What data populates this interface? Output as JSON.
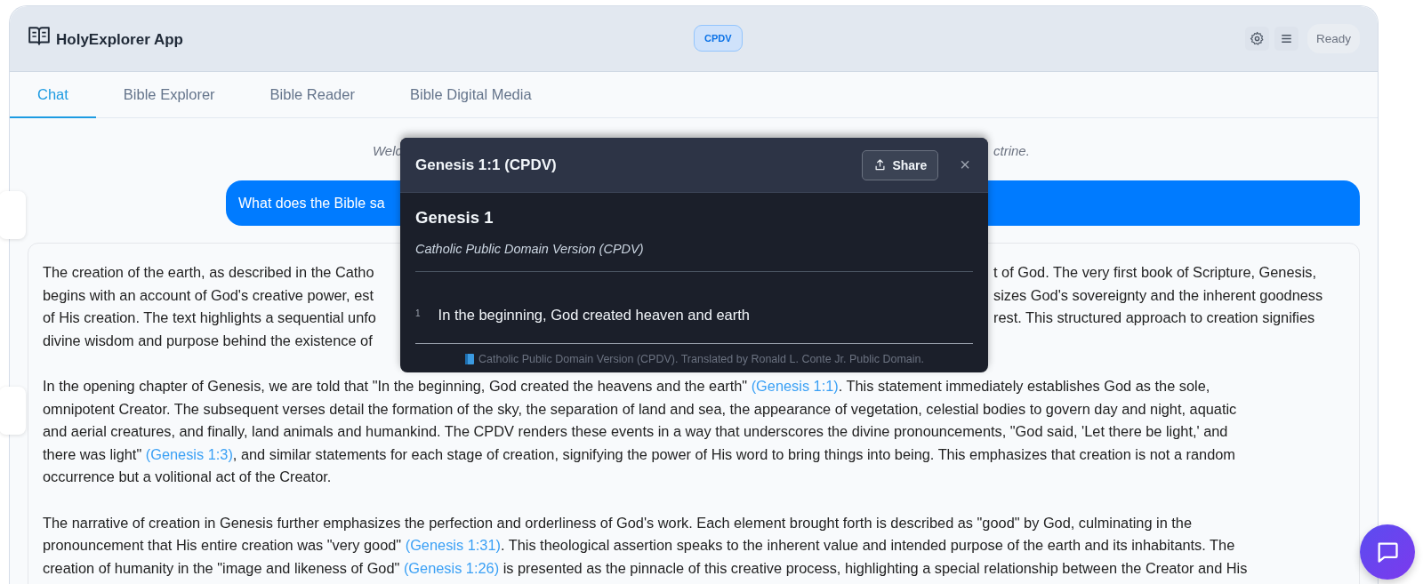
{
  "app": {
    "title": "HolyExplorer App",
    "version_badge": "CPDV",
    "status": "Ready"
  },
  "tabs": [
    {
      "label": "Chat",
      "selected": true
    },
    {
      "label": "Bible Explorer",
      "selected": false
    },
    {
      "label": "Bible Reader",
      "selected": false
    },
    {
      "label": "Bible Digital Media",
      "selected": false
    }
  ],
  "chat": {
    "welcome": {
      "left": "Welc",
      "right": "ctrine."
    },
    "user_message": "What does the Bible sa",
    "answer": {
      "paragraphs": [
        {
          "lines": [
            {
              "left": [
                {
                  "kind": "text",
                  "text": "The creation of the earth, as described in the Catho"
                }
              ],
              "right": [
                {
                  "kind": "text",
                  "text": "t of God. The very first book of Scripture, Genesis,"
                }
              ]
            },
            {
              "left": [
                {
                  "kind": "text",
                  "text": "begins with an account of God's creative power, est"
                }
              ],
              "right": [
                {
                  "kind": "text",
                  "text": "sizes God's sovereignty and the inherent goodness"
                }
              ]
            },
            {
              "left": [
                {
                  "kind": "text",
                  "text": "of His creation. The text highlights a sequential unfo"
                }
              ],
              "right": [
                {
                  "kind": "text",
                  "text": "rest. This structured approach to creation signifies"
                }
              ]
            },
            {
              "left": [
                {
                  "kind": "text",
                  "text": "divine wisdom and purpose behind the existence of"
                }
              ]
            }
          ]
        },
        {
          "lines": [
            {
              "left": [
                {
                  "kind": "text",
                  "text": "In the opening chapter of Genesis, we are told that \"In the beginning, God created the heavens and the earth\""
                },
                {
                  "kind": "link",
                  "text": "(Genesis 1:1)"
                },
                {
                  "kind": "text",
                  "text": ". This statement immediately establishes God as the sole,"
                }
              ]
            },
            {
              "left": [
                {
                  "kind": "text",
                  "text": "omnipotent Creator. The subsequent verses detail the formation of the sky, the separation of land and sea, the appearance of vegetation, celestial bodies to govern day and night, aquatic"
                }
              ]
            },
            {
              "left": [
                {
                  "kind": "text",
                  "text": "and aerial creatures, and finally, land animals and humankind. The CPDV renders these events in a way that underscores the divine pronouncements, \"God said, 'Let there be light,' and"
                }
              ]
            },
            {
              "left": [
                {
                  "kind": "text",
                  "text": "there was light\""
                },
                {
                  "kind": "link",
                  "text": "(Genesis 1:3)"
                },
                {
                  "kind": "text",
                  "text": ", and similar statements for each stage of creation, signifying the power of His word to bring things into being. This emphasizes that creation is not a random"
                }
              ]
            },
            {
              "left": [
                {
                  "kind": "text",
                  "text": "occurrence but a volitional act of the Creator."
                }
              ]
            }
          ]
        },
        {
          "lines": [
            {
              "left": [
                {
                  "kind": "text",
                  "text": "The narrative of creation in Genesis further emphasizes the perfection and orderliness of God's work. Each element brought forth is described as \"good\" by God, culminating in the"
                }
              ]
            },
            {
              "left": [
                {
                  "kind": "text",
                  "text": "pronouncement that His entire creation was \"very good\""
                },
                {
                  "kind": "link",
                  "text": "(Genesis 1:31)"
                },
                {
                  "kind": "text",
                  "text": ". This theological assertion speaks to the inherent value and intended purpose of the earth and its inhabitants. The"
                }
              ]
            },
            {
              "left": [
                {
                  "kind": "text",
                  "text": "creation of humanity in the \"image and likeness of God\""
                },
                {
                  "kind": "link",
                  "text": "(Genesis 1:26)"
                },
                {
                  "kind": "text",
                  "text": " is presented as the pinnacle of this creative process, highlighting a special relationship between the Creator and His"
                }
              ]
            }
          ]
        }
      ]
    }
  },
  "verse_popup": {
    "title": "Genesis 1:1 (CPDV)",
    "share_label": "Share",
    "close_label": "×",
    "chapter": "Genesis 1",
    "version": "Catholic Public Domain Version (CPDV)",
    "verses": [
      {
        "number": "1",
        "text": "In the beginning, God created heaven and earth"
      }
    ],
    "footer": "Catholic Public Domain Version (CPDV). Translated by Ronald L. Conte Jr. Public Domain."
  }
}
